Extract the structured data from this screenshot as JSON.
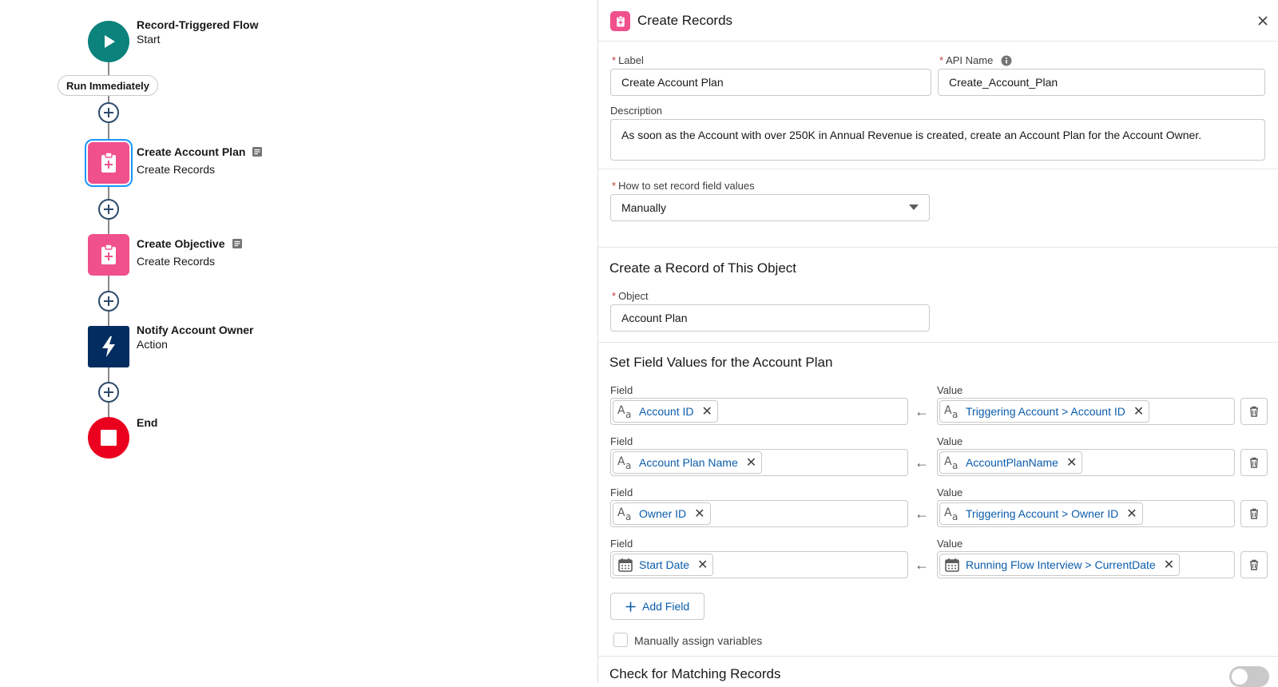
{
  "flow": {
    "start": {
      "title": "Record-Triggered Flow",
      "subtitle": "Start"
    },
    "run_pill": "Run Immediately",
    "elements": [
      {
        "title": "Create Account Plan",
        "subtitle": "Create Records"
      },
      {
        "title": "Create Objective",
        "subtitle": "Create Records"
      },
      {
        "title": "Notify Account Owner",
        "subtitle": "Action"
      }
    ],
    "end": {
      "title": "End"
    }
  },
  "panel": {
    "title": "Create Records",
    "label": {
      "label": "Label",
      "value": "Create Account Plan"
    },
    "api_name": {
      "label": "API Name",
      "value": "Create_Account_Plan"
    },
    "description": {
      "label": "Description",
      "value": "As soon as the Account with over 250K in Annual Revenue is created, create an Account Plan for the Account Owner."
    },
    "how_to_set": {
      "label": "How to set record field values",
      "value": "Manually"
    },
    "object_section": {
      "title": "Create a Record of This Object",
      "label": "Object",
      "value": "Account Plan"
    },
    "field_values_section": {
      "title": "Set Field Values for the Account Plan",
      "field_label": "Field",
      "value_label": "Value",
      "rows": [
        {
          "field": "Account ID",
          "field_icon": "text-icon",
          "value": "Triggering Account > Account ID",
          "value_icon": "text-icon"
        },
        {
          "field": "Account Plan Name",
          "field_icon": "text-icon",
          "value": "AccountPlanName",
          "value_icon": "text-icon"
        },
        {
          "field": "Owner ID",
          "field_icon": "text-icon",
          "value": "Triggering Account > Owner ID",
          "value_icon": "text-icon"
        },
        {
          "field": "Start Date",
          "field_icon": "calendar-icon",
          "value": "Running Flow Interview > CurrentDate",
          "value_icon": "calendar-icon"
        }
      ],
      "add_field": "Add Field",
      "manual_assign": "Manually assign variables"
    },
    "matching_section": {
      "title": "Check for Matching Records"
    }
  },
  "colors": {
    "start_teal": "#0b827c",
    "create_pink": "#f0508c",
    "action_navy": "#032d60",
    "end_red": "#ea001e",
    "link_blue": "#0b5cab"
  }
}
